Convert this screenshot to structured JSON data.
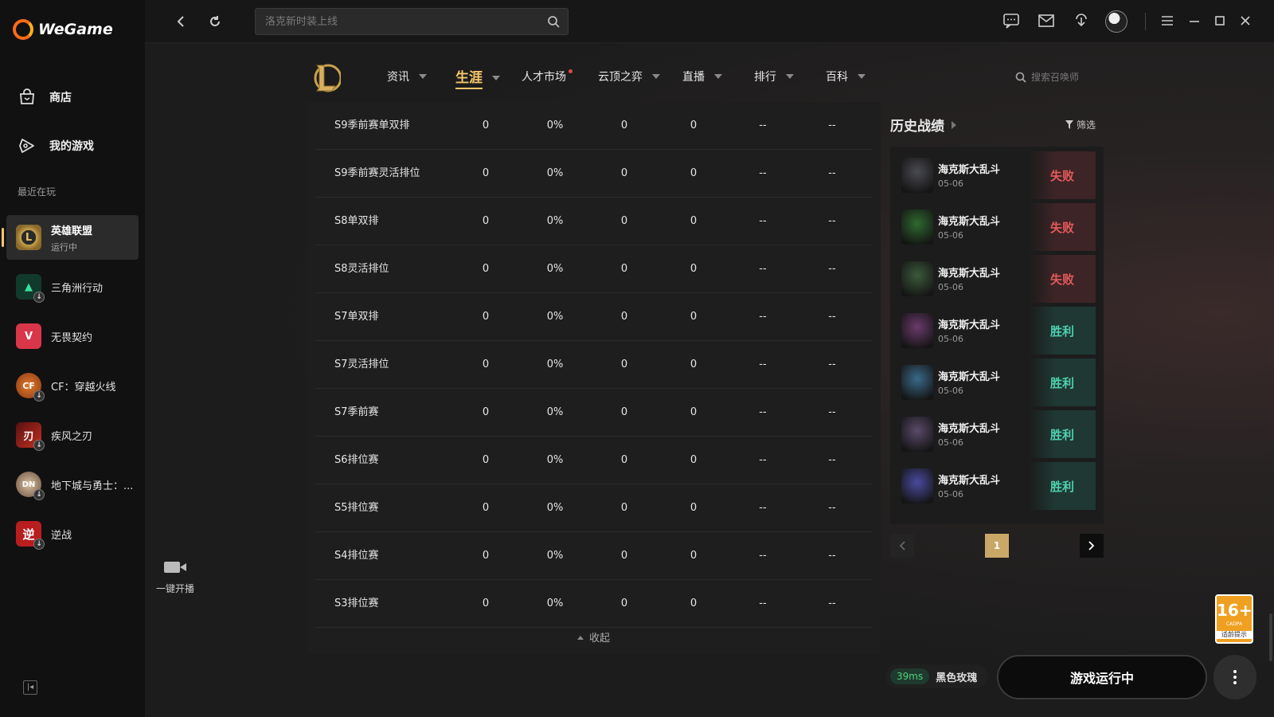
{
  "app": {
    "logo_text": "WeGame"
  },
  "sidebar": {
    "nav": [
      {
        "label": "商店",
        "icon": "shop-bag-icon"
      },
      {
        "label": "我的游戏",
        "icon": "gamepad-icon"
      }
    ],
    "recent_label": "最近在玩",
    "games": [
      {
        "name": "英雄联盟",
        "status": "运行中",
        "active": true,
        "color": "#c9a24d",
        "glyph": "L"
      },
      {
        "name": "三角洲行动",
        "color": "#1f6b4f",
        "glyph": "▲"
      },
      {
        "name": "无畏契约",
        "color": "#d9364a",
        "glyph": "V"
      },
      {
        "name": "CF：穿越火线",
        "color": "#b8682c",
        "glyph": "CF"
      },
      {
        "name": "疾风之刃",
        "color": "#8b2323",
        "glyph": "刃"
      },
      {
        "name": "地下城与勇士：...",
        "color": "#7a6a5a",
        "glyph": "DN"
      },
      {
        "name": "逆战",
        "color": "#b81e1e",
        "glyph": "逆"
      }
    ],
    "collapse_icon": "collapse-left-icon"
  },
  "topbar": {
    "search_placeholder": "洛克新时装上线"
  },
  "game_nav": {
    "items": [
      {
        "label": "资讯",
        "caret": true
      },
      {
        "label": "生涯",
        "caret": true,
        "active": true
      },
      {
        "label": "人才市场",
        "dot": true
      },
      {
        "label": "云顶之弈",
        "caret": true
      },
      {
        "label": "直播",
        "caret": true
      },
      {
        "label": "排行",
        "caret": true
      },
      {
        "label": "百科",
        "caret": true
      }
    ],
    "summoner_search": "搜索召唤师"
  },
  "season_table": {
    "rows": [
      {
        "name": "S9季前赛单双排",
        "v1": "0",
        "v2": "0%",
        "v3": "0",
        "v4": "0",
        "v5": "--",
        "v6": "--"
      },
      {
        "name": "S9季前赛灵活排位",
        "v1": "0",
        "v2": "0%",
        "v3": "0",
        "v4": "0",
        "v5": "--",
        "v6": "--"
      },
      {
        "name": "S8单双排",
        "v1": "0",
        "v2": "0%",
        "v3": "0",
        "v4": "0",
        "v5": "--",
        "v6": "--"
      },
      {
        "name": "S8灵活排位",
        "v1": "0",
        "v2": "0%",
        "v3": "0",
        "v4": "0",
        "v5": "--",
        "v6": "--"
      },
      {
        "name": "S7单双排",
        "v1": "0",
        "v2": "0%",
        "v3": "0",
        "v4": "0",
        "v5": "--",
        "v6": "--"
      },
      {
        "name": "S7灵活排位",
        "v1": "0",
        "v2": "0%",
        "v3": "0",
        "v4": "0",
        "v5": "--",
        "v6": "--"
      },
      {
        "name": "S7季前赛",
        "v1": "0",
        "v2": "0%",
        "v3": "0",
        "v4": "0",
        "v5": "--",
        "v6": "--"
      },
      {
        "name": "S6排位赛",
        "v1": "0",
        "v2": "0%",
        "v3": "0",
        "v4": "0",
        "v5": "--",
        "v6": "--"
      },
      {
        "name": "S5排位赛",
        "v1": "0",
        "v2": "0%",
        "v3": "0",
        "v4": "0",
        "v5": "--",
        "v6": "--"
      },
      {
        "name": "S4排位赛",
        "v1": "0",
        "v2": "0%",
        "v3": "0",
        "v4": "0",
        "v5": "--",
        "v6": "--"
      },
      {
        "name": "S3排位赛",
        "v1": "0",
        "v2": "0%",
        "v3": "0",
        "v4": "0",
        "v5": "--",
        "v6": "--"
      }
    ],
    "collapse_label": "收起"
  },
  "history": {
    "title": "历史战绩",
    "filter_label": "筛选",
    "matches": [
      {
        "mode": "海克斯大乱斗",
        "date": "05-06",
        "result": "失败",
        "outcome": "lose",
        "avatar_color": "#4a4a52"
      },
      {
        "mode": "海克斯大乱斗",
        "date": "05-06",
        "result": "失败",
        "outcome": "lose",
        "avatar_color": "#2e6a2e"
      },
      {
        "mode": "海克斯大乱斗",
        "date": "05-06",
        "result": "失败",
        "outcome": "lose",
        "avatar_color": "#3b5a3b"
      },
      {
        "mode": "海克斯大乱斗",
        "date": "05-06",
        "result": "胜利",
        "outcome": "win",
        "avatar_color": "#6a3a6a"
      },
      {
        "mode": "海克斯大乱斗",
        "date": "05-06",
        "result": "胜利",
        "outcome": "win",
        "avatar_color": "#3a6a8a"
      },
      {
        "mode": "海克斯大乱斗",
        "date": "05-06",
        "result": "胜利",
        "outcome": "win",
        "avatar_color": "#5a4a6a"
      },
      {
        "mode": "海克斯大乱斗",
        "date": "05-06",
        "result": "胜利",
        "outcome": "win",
        "avatar_color": "#4a4aa0"
      }
    ],
    "page": "1"
  },
  "bottom": {
    "stream_label": "一键开播",
    "ping": "39ms",
    "region": "黑色玫瑰",
    "launch_label": "游戏运行中",
    "age_rating": "16+",
    "age_sub": "CADPA",
    "age_tip": "适龄提示"
  }
}
